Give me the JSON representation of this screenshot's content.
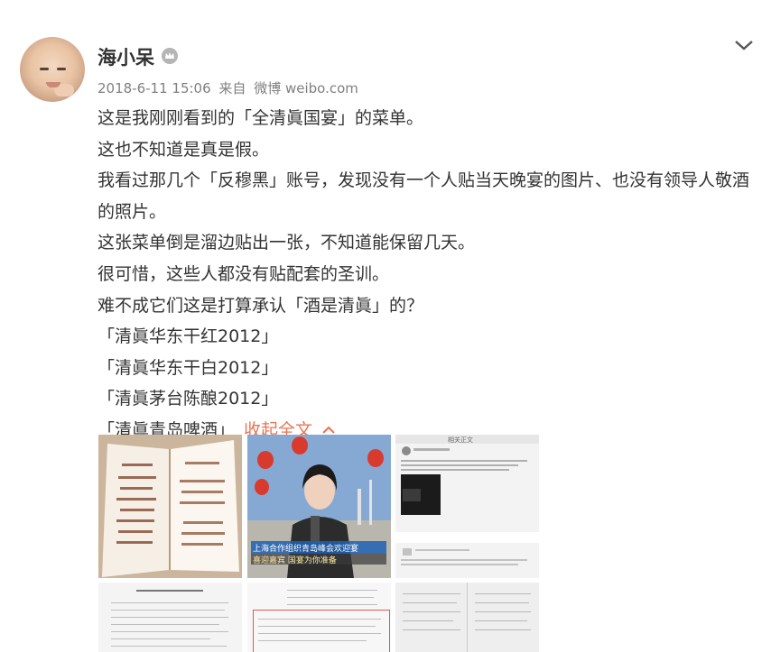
{
  "post": {
    "author": "海小呆",
    "date": "2018-6-11 15:06",
    "source_prefix": "来自",
    "source": "微博 weibo.com",
    "lines": [
      "这是我刚刚看到的「全清眞国宴」的菜单。",
      "这也不知道是真是假。",
      "我看过那几个「反穆黑」账号，发现没有一个人贴当天晚宴的图片、也没有领导人敬酒的照片。",
      "这张菜单倒是溜边贴出一张，不知道能保留几天。",
      "很可惜，这些人都没有贴配套的圣训。",
      "难不成它们这是打算承认「酒是清眞」的？",
      "「清眞华东干红2012」",
      "「清眞华东干白2012」",
      "「清眞茅台陈酿2012」",
      "「清眞青岛啤酒」"
    ],
    "collapse_label": "收起全文"
  },
  "images": {
    "news_caption": "上海合作组织青岛峰会欢迎宴 喜迎嘉宾 国宴为你准备",
    "screenshot_title": "相关正文"
  },
  "icons": {
    "vip": "crown-badge-icon",
    "menu": "chevron-down-icon",
    "collapse": "chevron-up-icon"
  },
  "colors": {
    "accent": "#eb7350",
    "text": "#333333",
    "meta": "#808080"
  }
}
